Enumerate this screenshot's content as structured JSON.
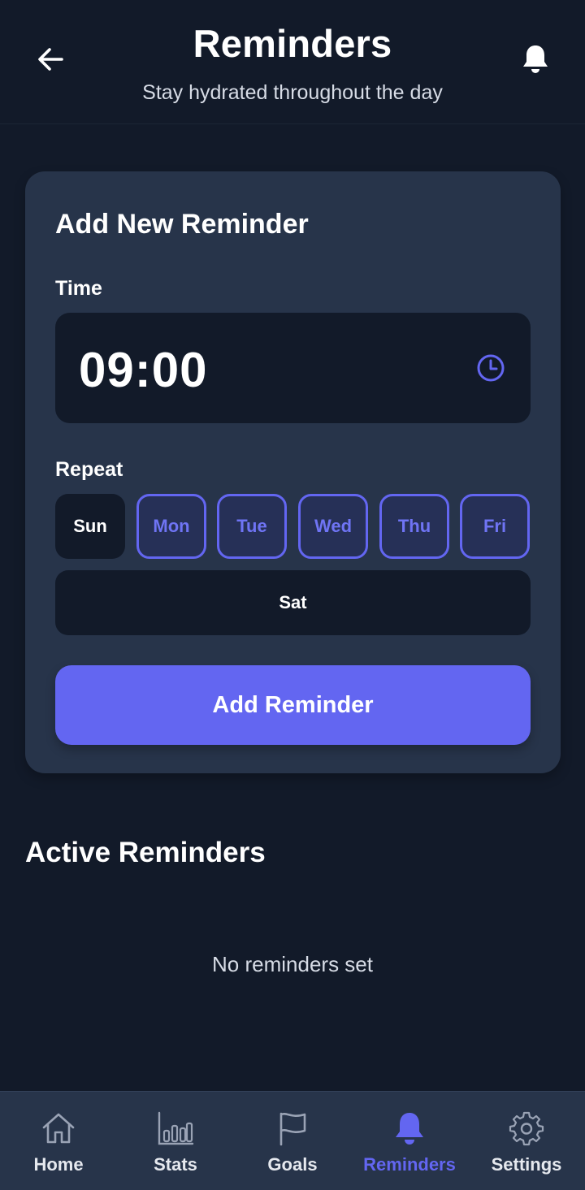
{
  "header": {
    "title": "Reminders",
    "subtitle": "Stay hydrated throughout the day",
    "back_icon": "arrow-left-icon",
    "notification_icon": "bell-icon"
  },
  "form": {
    "title": "Add New Reminder",
    "time_label": "Time",
    "time_value": "09:00",
    "time_icon": "clock-icon",
    "repeat_label": "Repeat",
    "days": [
      {
        "label": "Sun",
        "selected": false
      },
      {
        "label": "Mon",
        "selected": true
      },
      {
        "label": "Tue",
        "selected": true
      },
      {
        "label": "Wed",
        "selected": true
      },
      {
        "label": "Thu",
        "selected": true
      },
      {
        "label": "Fri",
        "selected": true
      },
      {
        "label": "Sat",
        "selected": false
      }
    ],
    "submit_label": "Add Reminder"
  },
  "active": {
    "title": "Active Reminders",
    "empty_text": "No reminders set"
  },
  "nav": {
    "items": [
      {
        "label": "Home",
        "icon": "home-icon",
        "active": false
      },
      {
        "label": "Stats",
        "icon": "bar-chart-icon",
        "active": false
      },
      {
        "label": "Goals",
        "icon": "flag-icon",
        "active": false
      },
      {
        "label": "Reminders",
        "icon": "bell-icon",
        "active": true
      },
      {
        "label": "Settings",
        "icon": "gear-icon",
        "active": false
      }
    ]
  },
  "colors": {
    "background": "#121a29",
    "card": "#27344a",
    "accent": "#6366f1",
    "text": "#ffffff",
    "muted_text": "#d7dce6"
  }
}
